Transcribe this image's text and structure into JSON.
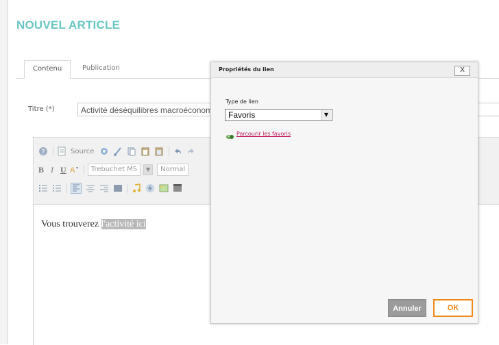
{
  "page": {
    "title": "NOUVEL ARTICLE"
  },
  "tabs": [
    {
      "label": "Contenu"
    },
    {
      "label": "Publication"
    }
  ],
  "title_field": {
    "label": "Titre (*)",
    "value": "Activité déséquilibres macroéconomiques"
  },
  "toolbar": {
    "source_label": "Source",
    "font_name": "Trebuchet MS",
    "format_label": "Normal",
    "bold": "B",
    "italic": "I",
    "underline": "U"
  },
  "editor": {
    "text_before": "Vous trouverez ",
    "selected_text": "l'activité ici"
  },
  "dialog": {
    "title": "Propriétés du lien",
    "close_label": "X",
    "link_type_label": "Type de lien",
    "link_type_value": "Favoris",
    "browse_label": "Parcourir les favoris",
    "cancel_label": "Annuler",
    "ok_label": "OK"
  },
  "colors": {
    "accent": "#6ac6c3",
    "ok_border": "#ee8a17",
    "link": "#c2185b",
    "cancel_bg": "#9b9b9b"
  },
  "icons": [
    "help-icon",
    "source-icon",
    "cut-icon",
    "copy-icon",
    "paste-icon",
    "undo-icon",
    "font-color-icon",
    "numbered-list-icon",
    "bullet-list-icon",
    "align-left-icon",
    "align-center-icon",
    "align-right-icon",
    "justify-icon",
    "audio-icon",
    "flash-icon",
    "image-icon",
    "video-icon",
    "link-favorites-icon"
  ]
}
